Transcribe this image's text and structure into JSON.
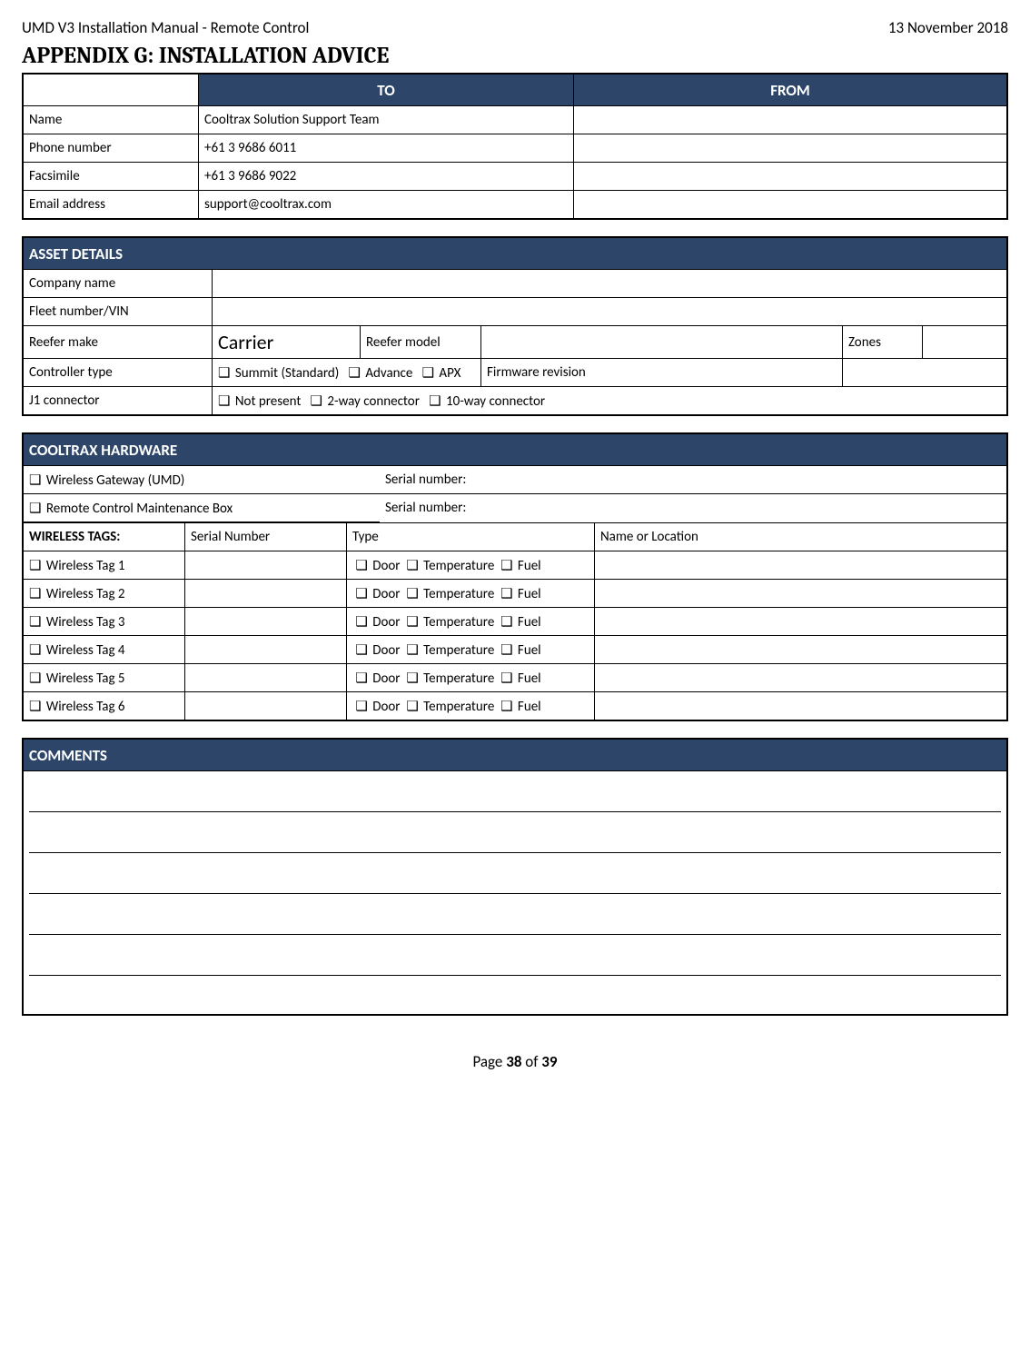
{
  "header": {
    "left": "UMD V3 Installation Manual - Remote Control",
    "right": "13 November 2018"
  },
  "title": "APPENDIX G: INSTALLATION ADVICE",
  "contact": {
    "to_label": "TO",
    "from_label": "FROM",
    "rows": {
      "name_label": "Name",
      "name_value": "Cooltrax Solution Support Team",
      "phone_label": "Phone number",
      "phone_value": "+61 3 9686 6011",
      "fax_label": "Facsimile",
      "fax_value": "+61 3 9686 9022",
      "email_label": "Email address",
      "email_value": "support@cooltrax.com"
    }
  },
  "asset": {
    "title": "ASSET DETAILS",
    "company_label": "Company name",
    "fleet_label": "Fleet number/VIN",
    "reefer_make_label": "Reefer make",
    "reefer_make_value": "Carrier",
    "reefer_model_label": "Reefer model",
    "zones_label": "Zones",
    "controller_label": "Controller type",
    "controller_options": {
      "summit": "Summit (Standard)",
      "advance": "Advance",
      "apx": "APX"
    },
    "firmware_label": "Firmware revision",
    "j1_label": "J1 connector",
    "j1_options": {
      "none": "Not present",
      "two": "2-way connector",
      "ten": "10-way connector"
    }
  },
  "hw": {
    "title": "COOLTRAX HARDWARE",
    "gateway_label": "Wireless Gateway (UMD)",
    "rcmb_label": "Remote Control Maintenance Box",
    "serial_label": "Serial number:",
    "wt_title": "WIRELESS TAGS:",
    "col_serial": "Serial Number",
    "col_type": "Type",
    "col_name": "Name or Location",
    "type_options": {
      "door": "Door",
      "temp": "Temperature",
      "fuel": "Fuel"
    },
    "tags": [
      "Wireless Tag 1",
      "Wireless Tag 2",
      "Wireless Tag 3",
      "Wireless Tag 4",
      "Wireless Tag 5",
      "Wireless Tag 6"
    ]
  },
  "comments_title": "COMMENTS",
  "footer": {
    "prefix": "Page ",
    "page": "38",
    "of": " of ",
    "total": "39"
  },
  "checkbox_glyph": "❑"
}
